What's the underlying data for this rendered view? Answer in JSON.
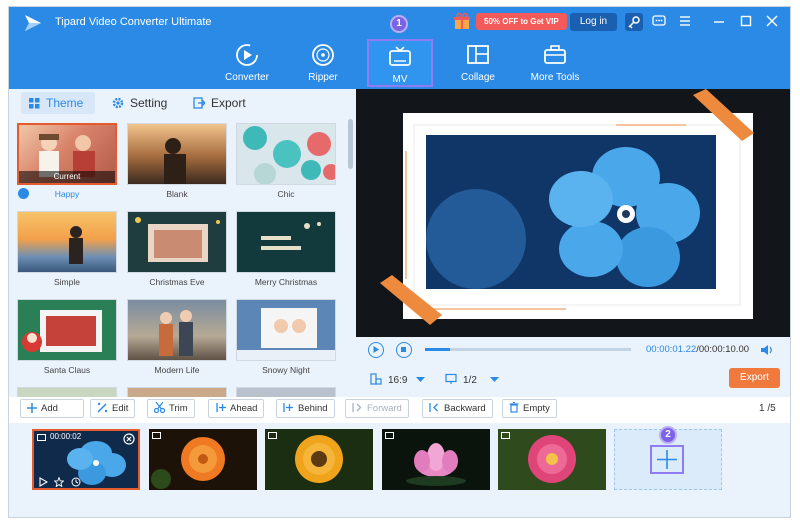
{
  "app": {
    "title": "Tipard Video Converter Ultimate"
  },
  "titlebar": {
    "promo": "50% OFF to Get VIP",
    "login": "Log in"
  },
  "nav": {
    "tabs": [
      {
        "label": "Converter",
        "icon": "converter-icon"
      },
      {
        "label": "Ripper",
        "icon": "ripper-icon"
      },
      {
        "label": "MV",
        "icon": "mv-icon",
        "active": true
      },
      {
        "label": "Collage",
        "icon": "collage-icon"
      },
      {
        "label": "More Tools",
        "icon": "toolbox-icon"
      }
    ],
    "badge1": "1"
  },
  "left_tabs": [
    {
      "label": "Theme",
      "active": true
    },
    {
      "label": "Setting"
    },
    {
      "label": "Export"
    }
  ],
  "themes": [
    {
      "label": "Happy",
      "selected": true,
      "tag": "Current"
    },
    {
      "label": "Blank"
    },
    {
      "label": "Chic"
    },
    {
      "label": "Simple"
    },
    {
      "label": "Christmas Eve"
    },
    {
      "label": "Merry Christmas"
    },
    {
      "label": "Santa Claus"
    },
    {
      "label": "Modern Life"
    },
    {
      "label": "Snowy Night"
    }
  ],
  "player": {
    "current_time": "00:00:01.22",
    "total_time": "/00:00:10.00",
    "progress": 0.12,
    "ratio": "16:9",
    "page": "1/2",
    "export_label": "Export"
  },
  "toolbar": {
    "add": "Add",
    "edit": "Edit",
    "trim": "Trim",
    "ahead": "Ahead",
    "behind": "Behind",
    "forward": "Forward",
    "backward": "Backward",
    "empty": "Empty",
    "counter_current": "1",
    "counter_sep": "/",
    "counter_total": "5"
  },
  "timeline": {
    "first_clip_time": "00:00:02",
    "badge2": "2"
  },
  "colors": {
    "accent": "#2b8ae5",
    "orange": "#f07a3d",
    "highlight": "#8f7cf2"
  }
}
